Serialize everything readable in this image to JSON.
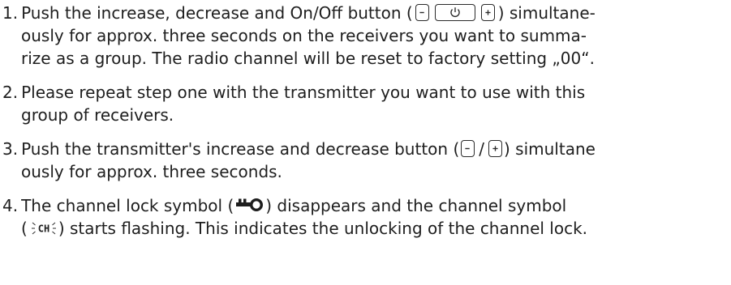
{
  "steps": [
    {
      "number": "1.",
      "line1_a": "Push the increase, decrease and On/Off button (",
      "line1_b": ") simultane-",
      "line2": "ously for approx. three seconds on the receivers you want to summa-",
      "line3": "rize as a group. The radio channel will be reset to factory setting „00“."
    },
    {
      "number": "2.",
      "line1": "Please repeat step one with the transmitter you want to use with this",
      "line2": "group of receivers."
    },
    {
      "number": "3.",
      "line1_a": "Push the transmitter's increase and decrease button (",
      "line1_sep": "/",
      "line1_b": ") simultane",
      "line2": "ously for approx. three seconds."
    },
    {
      "number": "4.",
      "line1_a": "The channel lock symbol (",
      "line1_b": ") disappears and the channel symbol",
      "line2_a": "(",
      "line2_b": ") starts flashing. This indicates the unlocking of the channel lock.",
      "ch_icon_text": "CH"
    }
  ],
  "icons": {
    "decrease": "minus-button-icon",
    "power": "power-button-icon",
    "increase": "plus-button-icon",
    "lock": "key-lock-icon",
    "channel": "channel-flashing-icon"
  }
}
